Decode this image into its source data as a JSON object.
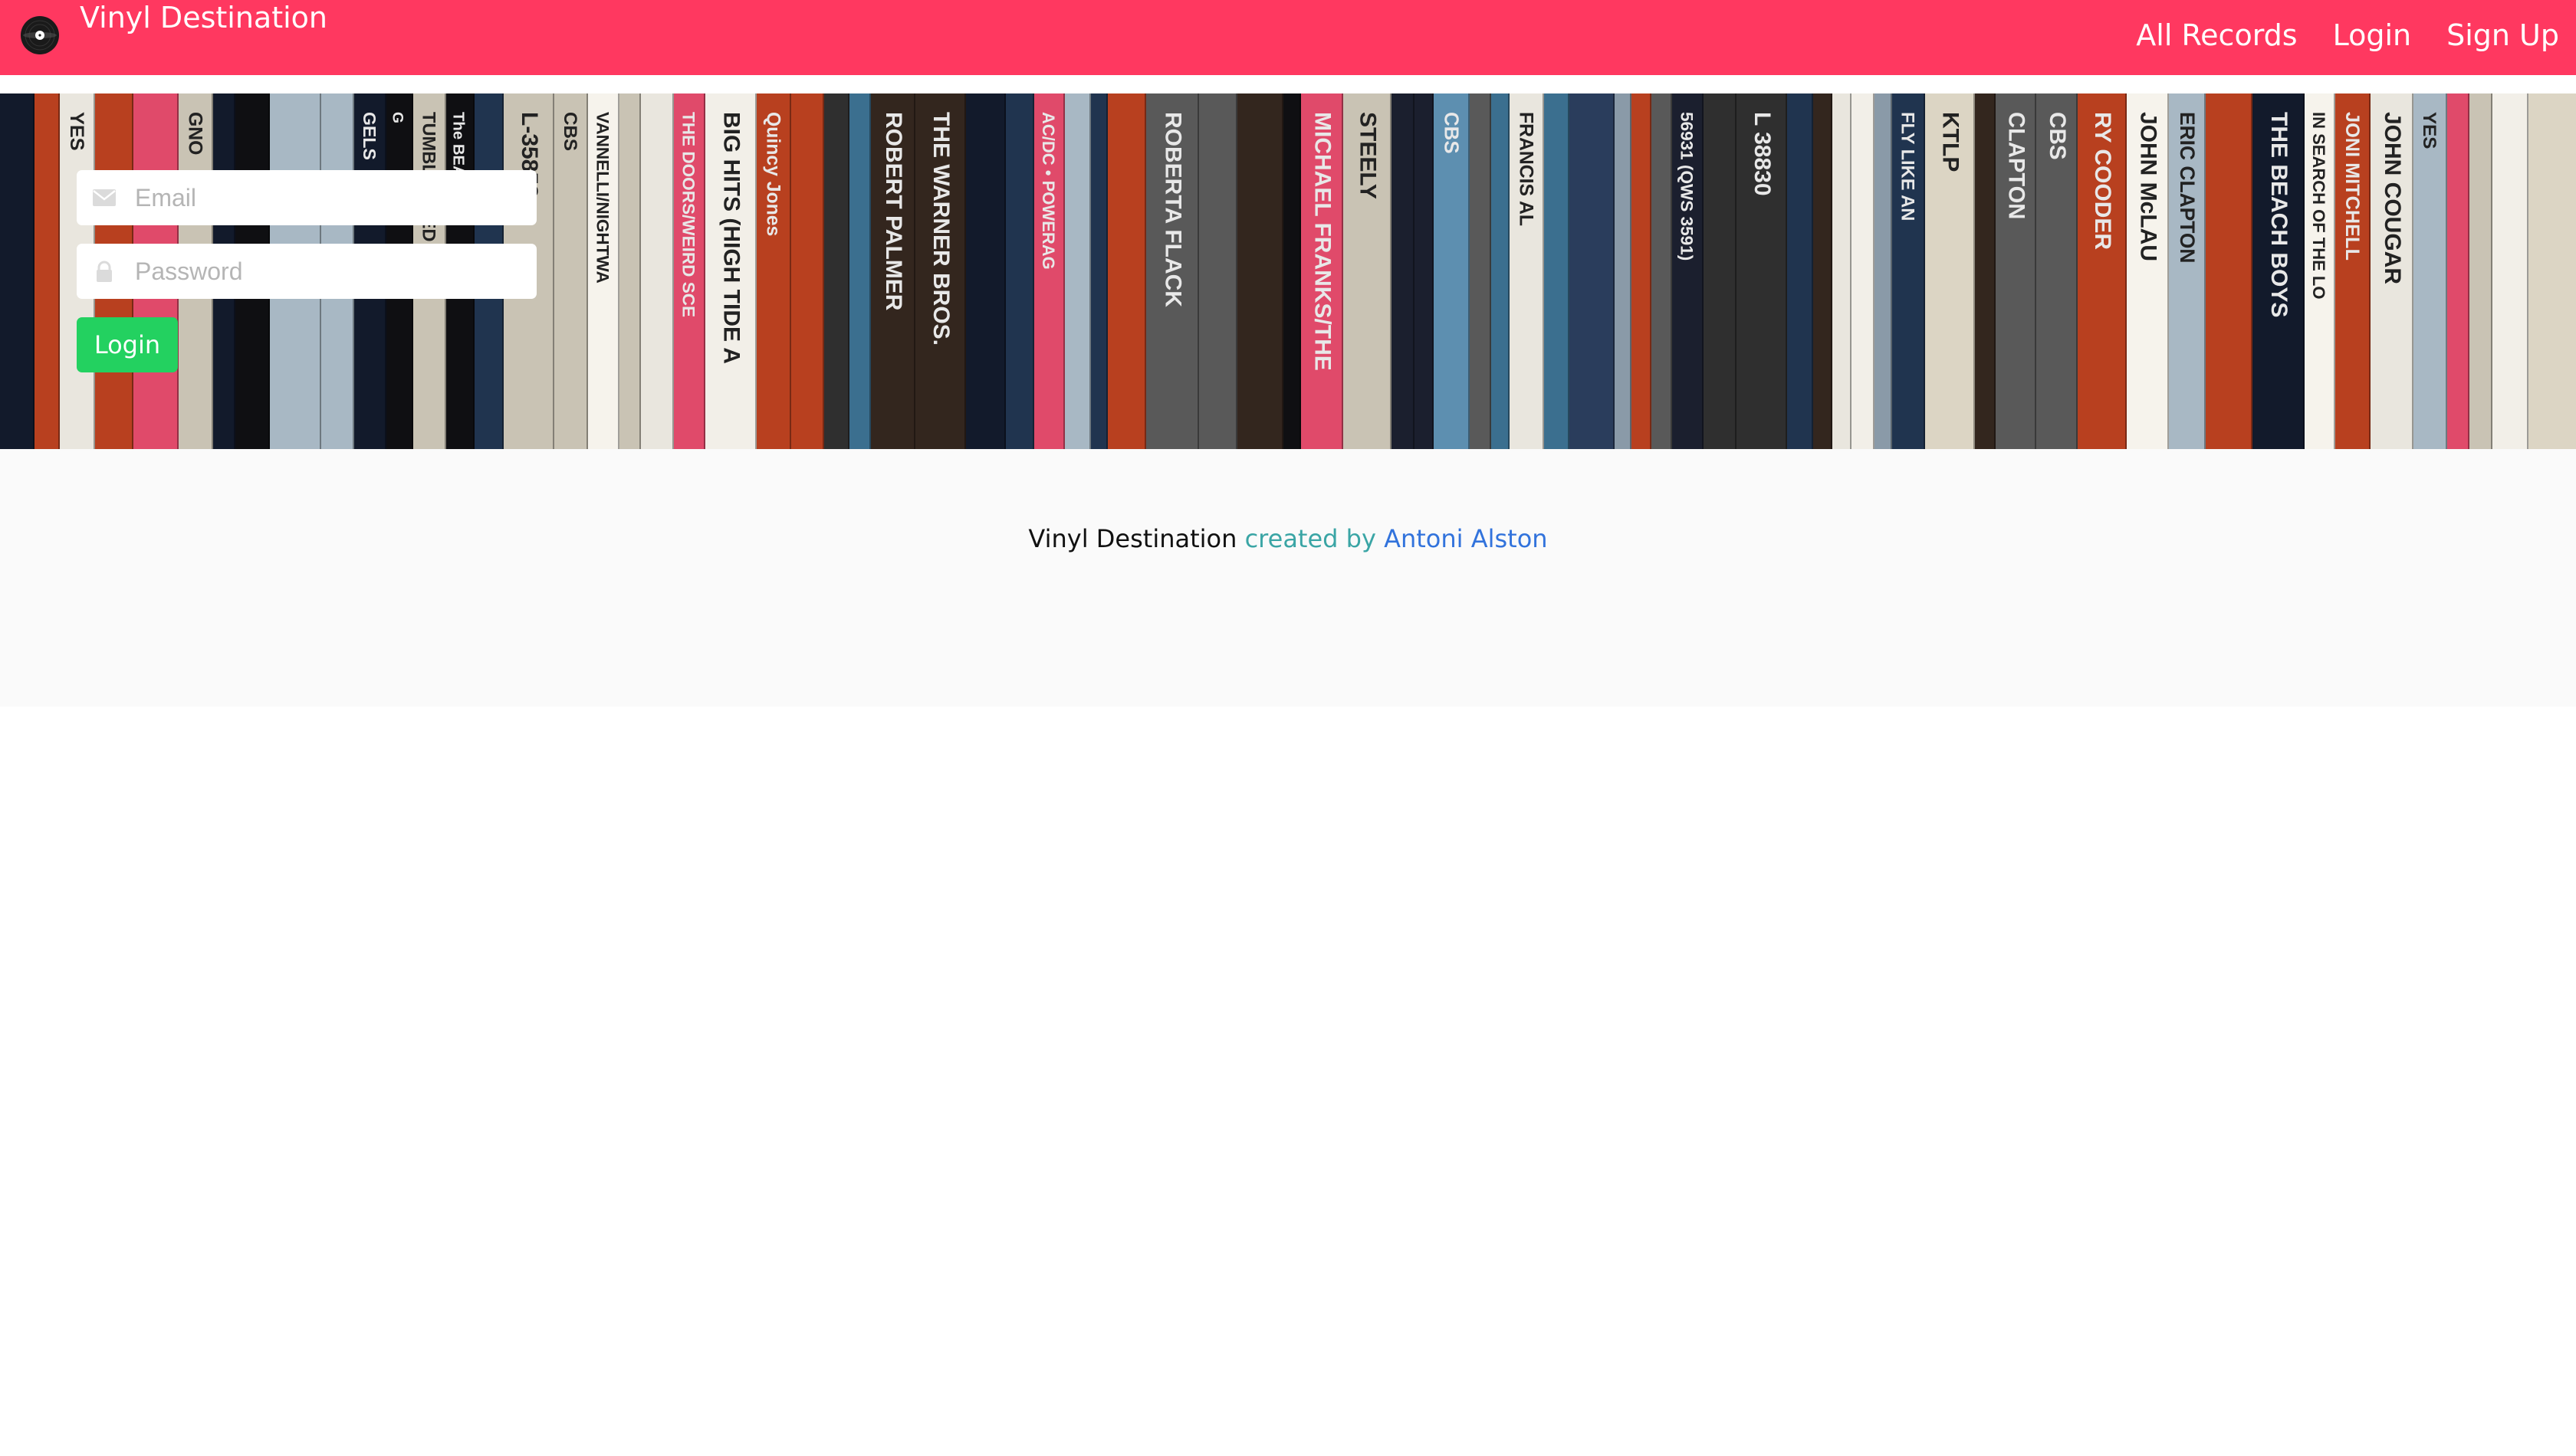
{
  "navbar": {
    "brand": "Vinyl Destination",
    "brand_icon": "vinyl-record-icon",
    "links": [
      "All Records",
      "Login",
      "Sign Up"
    ]
  },
  "hero": {
    "image": "record-spines-shelf",
    "spine_texts": [
      "YES",
      "GNO",
      "GELS",
      "G",
      "TUMBLEWEED C",
      "The BEATLES",
      "L-35853",
      "CBS",
      "VANNELLI/NIGHTWA",
      "THE DOORS/WEIRD SCE",
      "BIG HITS (HIGH TIDE A",
      "Quincy Jones",
      "ROBERT PALMER",
      "THE WARNER BROS.",
      "AC/DC • POWERAG",
      "ROBERTA FLACK",
      "MICHAEL FRANKS/THE",
      "STEELY",
      "CBS",
      "FRANCIS AL",
      "56931 (QWS 3591)",
      "L 38830",
      "FLY LIKE AN",
      "KTLP",
      "CLAPTON",
      "CBS",
      "RY COODER",
      "JOHN McLAU",
      "ERIC CLAPTON",
      "THE BEACH BOYS",
      "IN SEARCH OF THE LO",
      "JONI MITCHELL",
      "JOHN COUGAR",
      "YES"
    ]
  },
  "login_form": {
    "email_placeholder": "Email",
    "password_placeholder": "Password",
    "email_icon": "envelope-icon",
    "password_icon": "lock-icon",
    "submit_label": "Login"
  },
  "footer": {
    "brand": "Vinyl Destination",
    "created_by": "created by",
    "author": "Antoni Alston"
  },
  "colors": {
    "navbar": "#ff3860",
    "login_button": "#23d160",
    "footer_bg": "#fafafa",
    "created_by": "#3aa5a5",
    "author_link": "#3273dc"
  }
}
